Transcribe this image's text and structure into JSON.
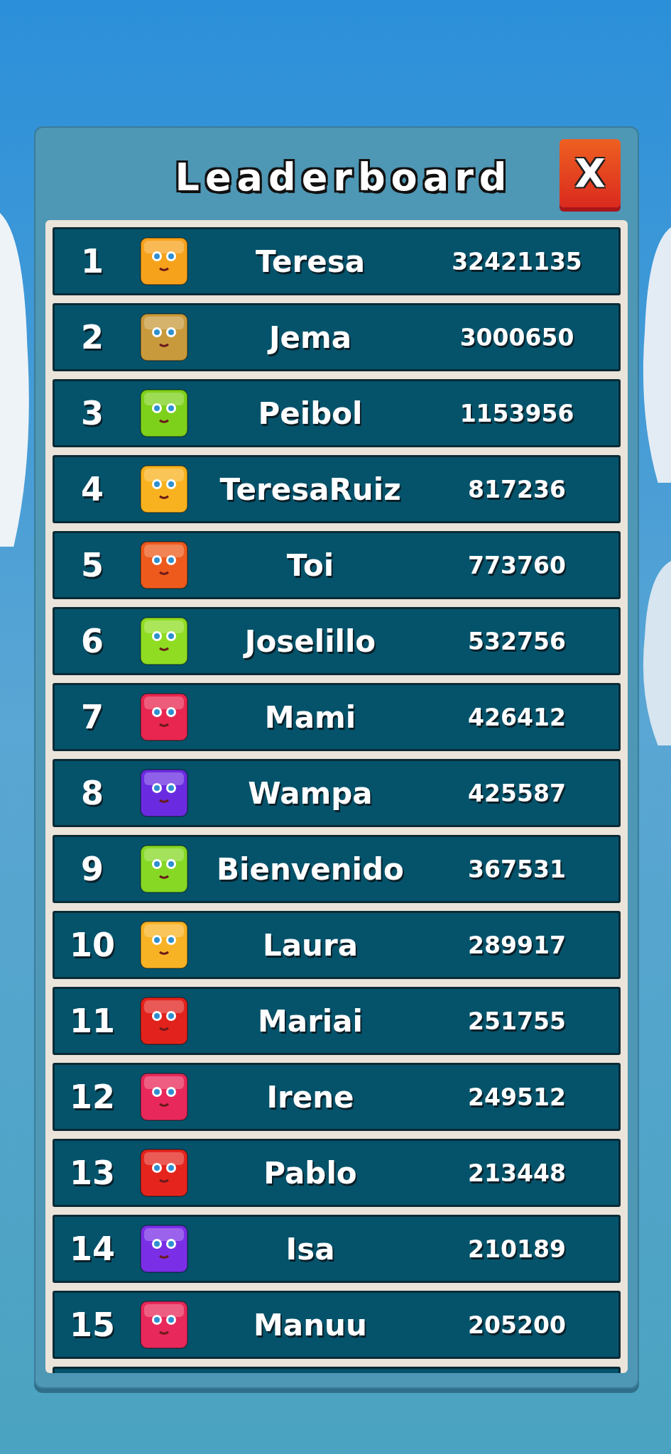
{
  "title": "Leaderboard",
  "close_button": {
    "label": "X"
  },
  "rows": [
    {
      "rank": "1",
      "name": "Teresa",
      "score": "32421135",
      "color": "#f7a21b"
    },
    {
      "rank": "2",
      "name": "Jema",
      "score": "3000650",
      "color": "#c99a3c"
    },
    {
      "rank": "3",
      "name": "Peibol",
      "score": "1153956",
      "color": "#7ed11a"
    },
    {
      "rank": "4",
      "name": "TeresaRuiz",
      "score": "817236",
      "color": "#f9b21f"
    },
    {
      "rank": "5",
      "name": "Toi",
      "score": "773760",
      "color": "#ee5a1c"
    },
    {
      "rank": "6",
      "name": "Joselillo",
      "score": "532756",
      "color": "#8fdc22"
    },
    {
      "rank": "7",
      "name": "Mami",
      "score": "426412",
      "color": "#e8264f"
    },
    {
      "rank": "8",
      "name": "Wampa",
      "score": "425587",
      "color": "#6a2be0"
    },
    {
      "rank": "9",
      "name": "Bienvenido",
      "score": "367531",
      "color": "#86d824"
    },
    {
      "rank": "10",
      "name": "Laura",
      "score": "289917",
      "color": "#f8b325"
    },
    {
      "rank": "11",
      "name": "Mariai",
      "score": "251755",
      "color": "#e2221c"
    },
    {
      "rank": "12",
      "name": "Irene",
      "score": "249512",
      "color": "#e8285a"
    },
    {
      "rank": "13",
      "name": "Pablo",
      "score": "213448",
      "color": "#e5241e"
    },
    {
      "rank": "14",
      "name": "Isa",
      "score": "210189",
      "color": "#7a2fe6"
    },
    {
      "rank": "15",
      "name": "Manuu",
      "score": "205200",
      "color": "#e8285a"
    }
  ]
}
